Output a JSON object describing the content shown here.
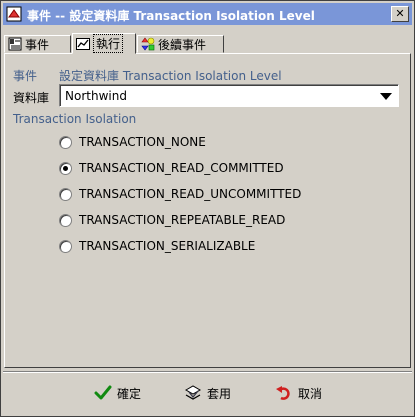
{
  "window": {
    "title": "事件 -- 設定資料庫 Transaction Isolation Level",
    "close_label": "✕"
  },
  "tabs": [
    {
      "label": "事件",
      "icon": "event-doc-icon",
      "active": false
    },
    {
      "label": "執行",
      "icon": "chart-icon",
      "active": true
    },
    {
      "label": "後續事件",
      "icon": "shapes-icon",
      "active": false
    }
  ],
  "event": {
    "label": "事件",
    "value": "設定資料庫 Transaction Isolation Level"
  },
  "database": {
    "label": "資料庫",
    "selected": "Northwind"
  },
  "isolation": {
    "label": "Transaction Isolation",
    "options": [
      {
        "label": "TRANSACTION_NONE",
        "checked": false
      },
      {
        "label": "TRANSACTION_READ_COMMITTED",
        "checked": true
      },
      {
        "label": "TRANSACTION_READ_UNCOMMITTED",
        "checked": false
      },
      {
        "label": "TRANSACTION_REPEATABLE_READ",
        "checked": false
      },
      {
        "label": "TRANSACTION_SERIALIZABLE",
        "checked": false
      }
    ]
  },
  "buttons": {
    "ok": "確定",
    "apply": "套用",
    "cancel": "取消"
  },
  "colors": {
    "title_bar": "#7a96d8",
    "accent_text": "#44608c",
    "background": "#d4d0c8"
  }
}
